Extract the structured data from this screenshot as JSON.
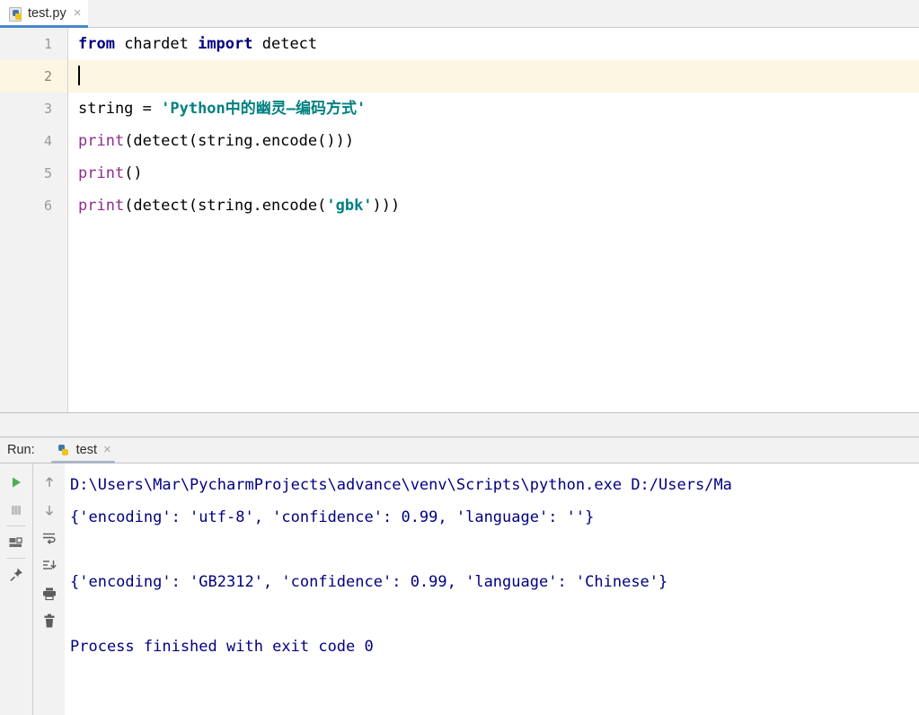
{
  "editor": {
    "tab": {
      "label": "test.py",
      "close": "×",
      "icon": "python-file-icon"
    },
    "lines": [
      {
        "num": "1",
        "current": false
      },
      {
        "num": "2",
        "current": true
      },
      {
        "num": "3",
        "current": false
      },
      {
        "num": "4",
        "current": false
      },
      {
        "num": "5",
        "current": false
      },
      {
        "num": "6",
        "current": false
      }
    ],
    "code": {
      "l1_kw_from": "from",
      "l1_mod": " chardet ",
      "l1_kw_import": "import",
      "l1_name": " detect",
      "l3_var": "string = ",
      "l3_str": "'Python中的幽灵–编码方式'",
      "l4_fn": "print",
      "l4_rest": "(detect(string.encode()))",
      "l5_fn": "print",
      "l5_rest": "()",
      "l6_fn": "print",
      "l6_a": "(detect(string.encode(",
      "l6_str": "'gbk'",
      "l6_b": ")))"
    }
  },
  "run_panel": {
    "title": "Run:",
    "tab": {
      "label": "test",
      "close": "×",
      "icon": "python-run-icon"
    },
    "toolbar_left": [
      {
        "name": "rerun-button",
        "icon": "play-triangle-icon"
      },
      {
        "name": "stop-button",
        "icon": "stop-square-icon"
      },
      {
        "name": "thread-dump-button",
        "icon": "dump-icon"
      },
      {
        "name": "pin-tab-button",
        "icon": "pin-icon"
      }
    ],
    "toolbar_right": [
      {
        "name": "up-the-stack-button",
        "icon": "arrow-up-icon"
      },
      {
        "name": "down-the-stack-button",
        "icon": "arrow-down-icon"
      },
      {
        "name": "soft-wrap-button",
        "icon": "soft-wrap-icon"
      },
      {
        "name": "scroll-to-end-button",
        "icon": "scroll-to-end-icon"
      },
      {
        "name": "print-button",
        "icon": "printer-icon"
      },
      {
        "name": "clear-all-button",
        "icon": "trash-icon"
      }
    ],
    "console_output": [
      "D:\\Users\\Mar\\PycharmProjects\\advance\\venv\\Scripts\\python.exe D:/Users/Ma",
      "{'encoding': 'utf-8', 'confidence': 0.99, 'language': ''}",
      "",
      "{'encoding': 'GB2312', 'confidence': 0.99, 'language': 'Chinese'}",
      "",
      "Process finished with exit code 0"
    ]
  },
  "colors": {
    "keyword": "#000080",
    "function": "#8d2e8d",
    "string": "#008080",
    "console_text": "#000080",
    "current_line": "#fcf6e3",
    "tab_accent": "#4a88c7"
  }
}
